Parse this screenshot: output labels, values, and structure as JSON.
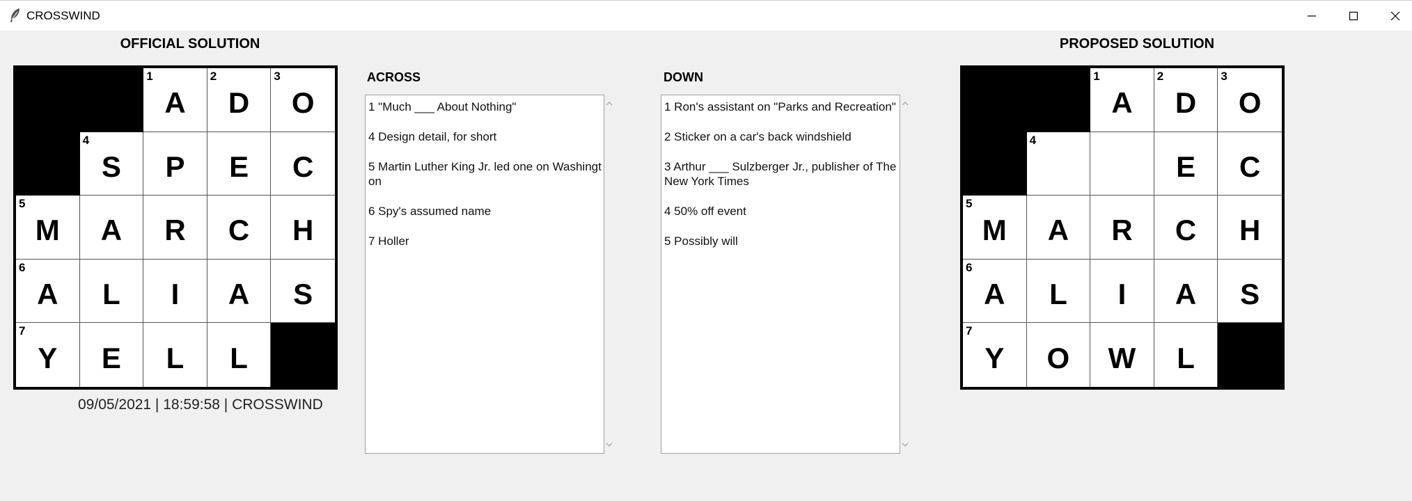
{
  "window": {
    "title": "CROSSWIND",
    "controls": {
      "minimize": "minimize-icon",
      "maximize": "maximize-icon",
      "close": "close-icon"
    }
  },
  "official": {
    "title": "OFFICIAL SOLUTION",
    "footer": "09/05/2021 | 18:59:58 | CROSSWIND",
    "grid": [
      [
        {
          "b": 1
        },
        {
          "b": 1
        },
        {
          "n": "1",
          "l": "A"
        },
        {
          "n": "2",
          "l": "D"
        },
        {
          "n": "3",
          "l": "O"
        }
      ],
      [
        {
          "b": 1
        },
        {
          "n": "4",
          "l": "S"
        },
        {
          "l": "P"
        },
        {
          "l": "E"
        },
        {
          "l": "C"
        }
      ],
      [
        {
          "n": "5",
          "l": "M"
        },
        {
          "l": "A"
        },
        {
          "l": "R"
        },
        {
          "l": "C"
        },
        {
          "l": "H"
        }
      ],
      [
        {
          "n": "6",
          "l": "A"
        },
        {
          "l": "L"
        },
        {
          "l": "I"
        },
        {
          "l": "A"
        },
        {
          "l": "S"
        }
      ],
      [
        {
          "n": "7",
          "l": "Y"
        },
        {
          "l": "E"
        },
        {
          "l": "L"
        },
        {
          "l": "L"
        },
        {
          "b": 1
        }
      ]
    ]
  },
  "proposed": {
    "title": "PROPOSED SOLUTION",
    "grid": [
      [
        {
          "b": 1
        },
        {
          "b": 1
        },
        {
          "n": "1",
          "l": "A"
        },
        {
          "n": "2",
          "l": "D"
        },
        {
          "n": "3",
          "l": "O"
        }
      ],
      [
        {
          "b": 1
        },
        {
          "n": "4",
          "l": ""
        },
        {
          "l": ""
        },
        {
          "l": "E"
        },
        {
          "l": "C"
        }
      ],
      [
        {
          "n": "5",
          "l": "M"
        },
        {
          "l": "A"
        },
        {
          "l": "R"
        },
        {
          "l": "C"
        },
        {
          "l": "H"
        }
      ],
      [
        {
          "n": "6",
          "l": "A"
        },
        {
          "l": "L"
        },
        {
          "l": "I"
        },
        {
          "l": "A"
        },
        {
          "l": "S"
        }
      ],
      [
        {
          "n": "7",
          "l": "Y"
        },
        {
          "l": "O"
        },
        {
          "l": "W"
        },
        {
          "l": "L"
        },
        {
          "b": 1
        }
      ]
    ]
  },
  "across": {
    "label": "ACROSS",
    "clues": [
      "1 \"Much ___ About Nothing\"",
      "4 Design detail, for short",
      "5 Martin Luther King Jr. led one on Washington",
      "6 Spy's assumed name",
      "7 Holler"
    ]
  },
  "down": {
    "label": "DOWN",
    "clues": [
      "1 Ron's assistant on \"Parks and Recreation\"",
      "2 Sticker on a car's back windshield",
      "3 Arthur ___ Sulzberger Jr., publisher of The New York Times",
      "4 50% off event",
      "5 Possibly will"
    ]
  }
}
